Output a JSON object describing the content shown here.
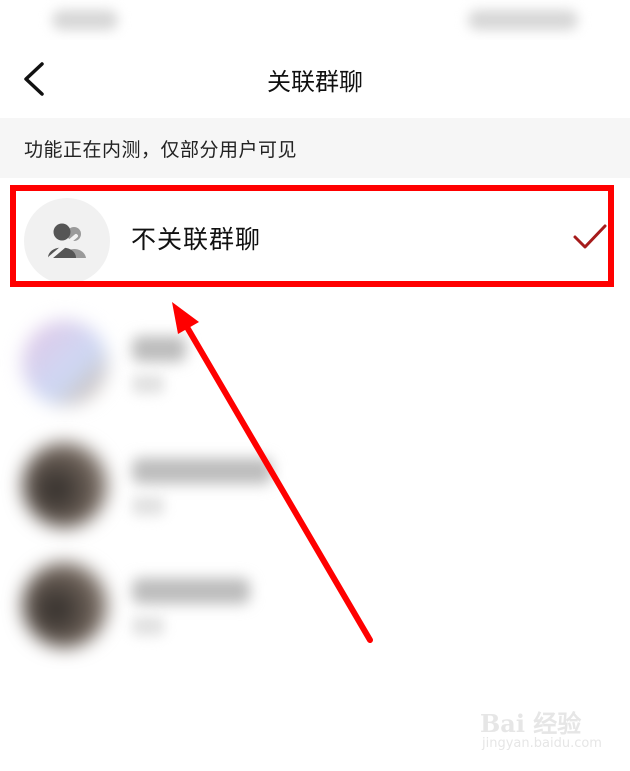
{
  "nav": {
    "title": "关联群聊"
  },
  "notice": {
    "text": "功能正在内测，仅部分用户可见"
  },
  "option": {
    "label": "不关联群聊",
    "selected": true
  },
  "colors": {
    "highlight": "#ff0000",
    "check": "#a61b1b",
    "notice_bg": "#f6f6f6"
  },
  "icons": {
    "back": "chevron-left-icon",
    "option_avatar": "group-off-icon",
    "check": "check-icon"
  },
  "groups": [
    {},
    {},
    {}
  ],
  "watermark": {
    "logo": "Bai 经验",
    "site": "jingyan.baidu.com"
  }
}
